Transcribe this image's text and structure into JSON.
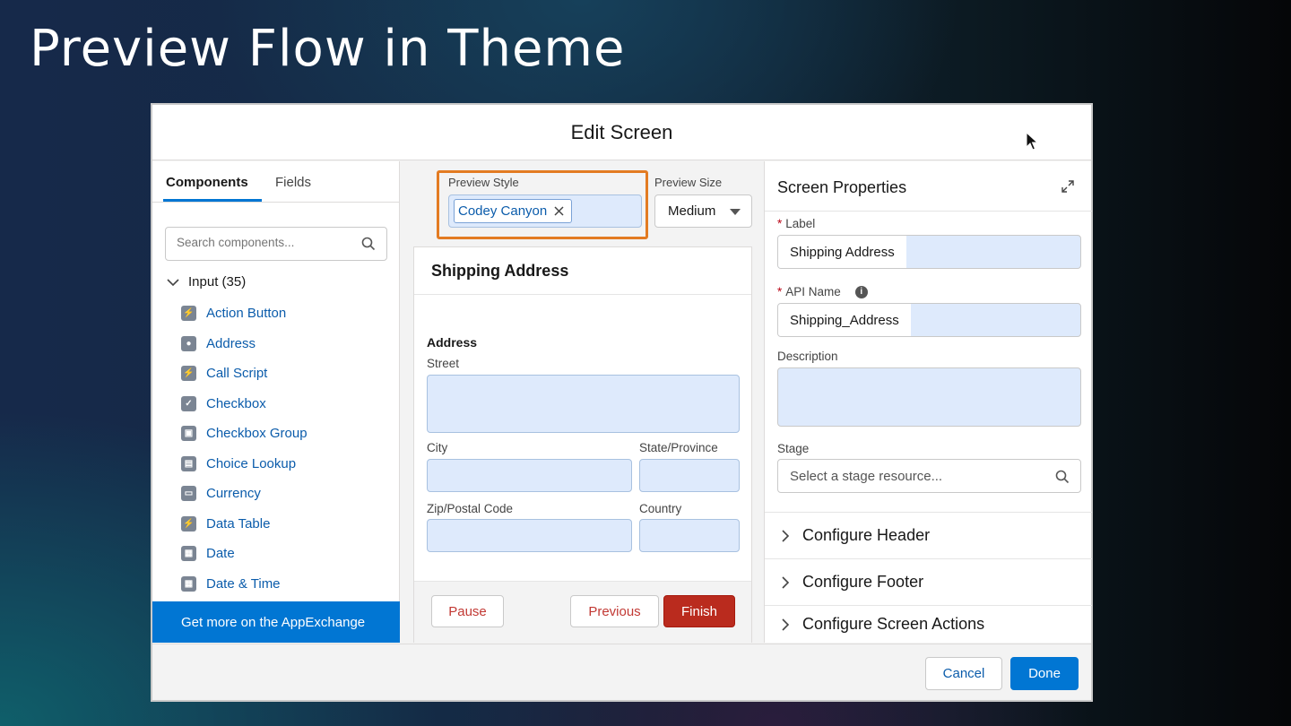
{
  "slide": {
    "title": "Preview Flow in Theme"
  },
  "modal": {
    "title": "Edit Screen"
  },
  "left": {
    "tabs": [
      "Components",
      "Fields"
    ],
    "search_placeholder": "Search components...",
    "section": "Input (35)",
    "components": [
      {
        "label": "Action Button",
        "icon": "lightning-icon"
      },
      {
        "label": "Address",
        "icon": "location-icon"
      },
      {
        "label": "Call Script",
        "icon": "lightning-icon"
      },
      {
        "label": "Checkbox",
        "icon": "checkbox-icon"
      },
      {
        "label": "Checkbox Group",
        "icon": "checkbox-group-icon"
      },
      {
        "label": "Choice Lookup",
        "icon": "lookup-icon"
      },
      {
        "label": "Currency",
        "icon": "currency-icon"
      },
      {
        "label": "Data Table",
        "icon": "lightning-icon"
      },
      {
        "label": "Date",
        "icon": "calendar-icon"
      },
      {
        "label": "Date & Time",
        "icon": "datetime-icon"
      }
    ],
    "appexchange": "Get more on the AppExchange"
  },
  "preview": {
    "style_label": "Preview Style",
    "style_value": "Codey Canyon",
    "size_label": "Preview Size",
    "size_value": "Medium",
    "card_title": "Shipping Address",
    "address_label": "Address",
    "street": "Street",
    "city": "City",
    "state": "State/Province",
    "zip": "Zip/Postal Code",
    "country": "Country",
    "pause": "Pause",
    "previous": "Previous",
    "finish": "Finish"
  },
  "props": {
    "title": "Screen Properties",
    "label_label": "Label",
    "label_value": "Shipping Address",
    "api_label": "API Name",
    "api_value": "Shipping_Address",
    "description_label": "Description",
    "stage_label": "Stage",
    "stage_placeholder": "Select a stage resource...",
    "accordions": [
      "Configure Header",
      "Configure Footer",
      "Configure Screen Actions"
    ]
  },
  "footer": {
    "cancel": "Cancel",
    "done": "Done"
  },
  "colors": {
    "brand": "#0176d3",
    "finish": "#ba2b1e",
    "highlight": "#e37b22"
  }
}
